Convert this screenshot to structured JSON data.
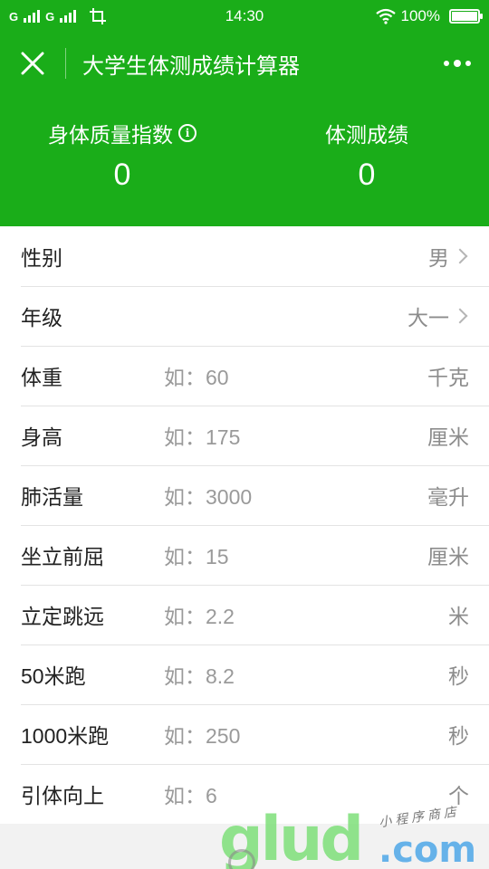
{
  "statusbar": {
    "carrier1": "G",
    "carrier2": "G",
    "time": "14:30",
    "battery": "100%",
    "battery_level": 1.0
  },
  "navbar": {
    "title": "大学生体测成绩计算器"
  },
  "scores": {
    "bmi_label": "身体质量指数",
    "bmi_value": "0",
    "score_label": "体测成绩",
    "score_value": "0"
  },
  "form": {
    "gender": {
      "label": "性别",
      "value": "男"
    },
    "grade": {
      "label": "年级",
      "value": "大一"
    },
    "fields": [
      {
        "label": "体重",
        "placeholder": "如：60",
        "unit": "千克"
      },
      {
        "label": "身高",
        "placeholder": "如：175",
        "unit": "厘米"
      },
      {
        "label": "肺活量",
        "placeholder": "如：3000",
        "unit": "毫升"
      },
      {
        "label": "坐立前屈",
        "placeholder": "如：15",
        "unit": "厘米"
      },
      {
        "label": "立定跳远",
        "placeholder": "如：2.2",
        "unit": "米"
      },
      {
        "label": "50米跑",
        "placeholder": "如：8.2",
        "unit": "秒"
      },
      {
        "label": "1000米跑",
        "placeholder": "如：250",
        "unit": "秒"
      },
      {
        "label": "引体向上",
        "placeholder": "如：6",
        "unit": "个"
      }
    ]
  },
  "watermark": {
    "brand": "glud",
    "tld": ".com",
    "tagline": "小程序商店"
  },
  "colors": {
    "header_green": "#1aad19"
  }
}
